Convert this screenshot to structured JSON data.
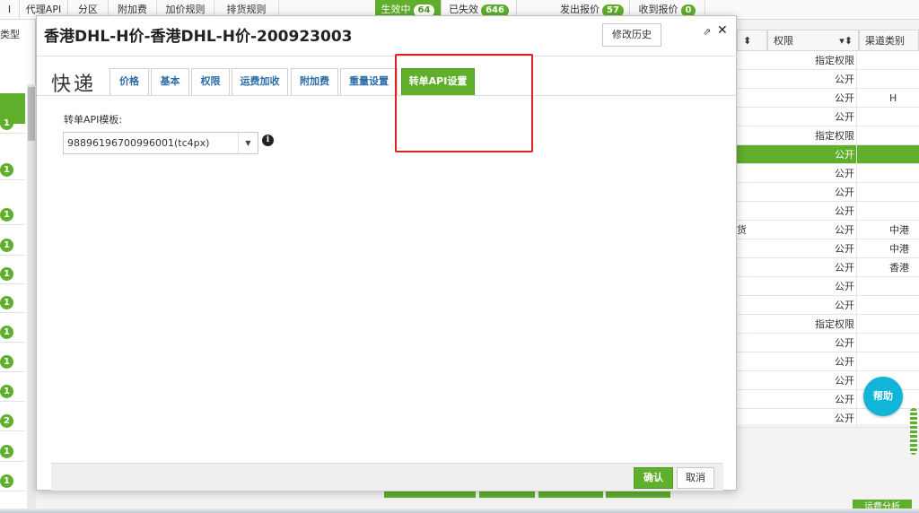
{
  "topnav": {
    "items": [
      {
        "label": "I"
      },
      {
        "label": "代理API"
      },
      {
        "label": "分区"
      },
      {
        "label": "附加费"
      },
      {
        "label": "加价规则"
      },
      {
        "label": "排货规则"
      }
    ],
    "status_tabs": [
      {
        "label": "生效中",
        "count": "64"
      },
      {
        "label": "已失效",
        "count": "646"
      },
      {
        "label": "发出报价",
        "count": "57"
      },
      {
        "label": "收到报价",
        "count": "0"
      }
    ]
  },
  "left_column": {
    "header": "类型",
    "badges": [
      "1",
      "1",
      "1",
      "1",
      "1",
      "1",
      "1",
      "1",
      "1",
      "2",
      "1",
      "1"
    ]
  },
  "right_table": {
    "headers": {
      "permission": "权限",
      "channel": "渠道类别"
    },
    "rows": [
      {
        "permission": "指定权限",
        "channel": "",
        "frag": ""
      },
      {
        "permission": "公开",
        "channel": "",
        "frag": ""
      },
      {
        "permission": "公开",
        "channel": "H",
        "frag": ""
      },
      {
        "permission": "公开",
        "channel": "",
        "frag": ""
      },
      {
        "permission": "指定权限",
        "channel": "",
        "frag": ""
      },
      {
        "permission": "公开",
        "channel": "",
        "frag": "",
        "selected": true
      },
      {
        "permission": "公开",
        "channel": "",
        "frag": ""
      },
      {
        "permission": "公开",
        "channel": "",
        "frag": ""
      },
      {
        "permission": "公开",
        "channel": "",
        "frag": ""
      },
      {
        "permission": "公开",
        "channel": "中港",
        "frag": "货"
      },
      {
        "permission": "公开",
        "channel": "中港",
        "frag": ""
      },
      {
        "permission": "公开",
        "channel": "香港",
        "frag": ""
      },
      {
        "permission": "公开",
        "channel": "",
        "frag": ""
      },
      {
        "permission": "公开",
        "channel": "",
        "frag": ""
      },
      {
        "permission": "指定权限",
        "channel": "",
        "frag": ""
      },
      {
        "permission": "公开",
        "channel": "",
        "frag": ""
      },
      {
        "permission": "公开",
        "channel": "",
        "frag": ""
      },
      {
        "permission": "公开",
        "channel": "",
        "frag": ""
      },
      {
        "permission": "公开",
        "channel": "",
        "frag": ""
      },
      {
        "permission": "公开",
        "channel": "",
        "frag": ""
      }
    ]
  },
  "help_button": {
    "label": "帮助"
  },
  "bottom_button": {
    "label": "运费分析"
  },
  "modal": {
    "title": "香港DHL-H价-香港DHL-H价-200923003",
    "history_button": "修改历史",
    "popout_icon": "external-link-icon",
    "close_icon": "close-icon",
    "logo_text": "快递",
    "tabs": [
      {
        "label": "价格"
      },
      {
        "label": "基本"
      },
      {
        "label": "权限"
      },
      {
        "label": "运费加收"
      },
      {
        "label": "附加费"
      },
      {
        "label": "重量设置"
      },
      {
        "label": "转单API设置",
        "active": true
      }
    ],
    "field_label": "转单API模板:",
    "select_value": "98896196700996001(tc4px)",
    "info_icon": "info-icon",
    "ok_button": "确认",
    "cancel_button": "取消"
  },
  "colors": {
    "accent_green": "#5fae2c",
    "annotation_red": "#e02020",
    "help_blue": "#11b5d8",
    "link_blue": "#2b6ca8"
  }
}
